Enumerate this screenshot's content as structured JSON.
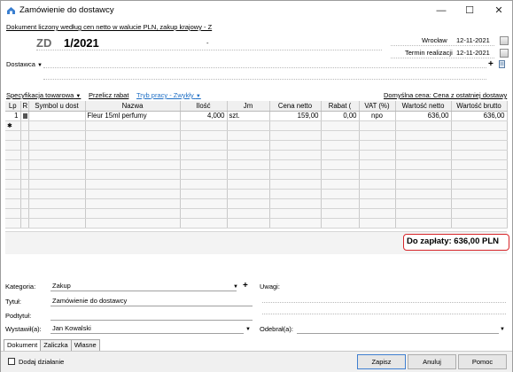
{
  "window": {
    "title": "Zamówienie do dostawcy",
    "minimize": "—",
    "maximize": "☐",
    "close": "✕"
  },
  "header": {
    "info_link": "Dokument liczony według cen netto w walucie PLN, zakup krajowy - Z",
    "doc_type": "ZD",
    "doc_number": "1/2021",
    "dash": "-",
    "place_label": "Wrocław",
    "place_date": "12-11-2021",
    "term_label": "Termin realizacji",
    "term_date": "12-11-2021",
    "supplier_label": "Dostawca",
    "plus": "+"
  },
  "toolbar": {
    "spec_label": "Specyfikacja towarowa",
    "recalc_label": "Przelicz rabat",
    "mode_label": "Tryb pracy - Zwykły",
    "default_price_label": "Domyślna cena: Cena z ostatniej dostawy"
  },
  "table": {
    "columns": [
      "Lp",
      "R",
      "Symbol u dost",
      "Nazwa",
      "Ilość",
      "Jm",
      "Cena netto",
      "Rabat (",
      "VAT (%)",
      "Wartość netto",
      "Wartość brutto"
    ],
    "rows": [
      [
        "1",
        "",
        "",
        "Fleur 15ml perfumy",
        "4,000",
        "szt.",
        "159,00",
        "0,00",
        "npo",
        "636,00",
        "636,00"
      ]
    ],
    "new_row_marker": "✱",
    "empty_rows": 11
  },
  "summary": {
    "to_pay": "Do zapłaty: 636,00 PLN"
  },
  "form": {
    "category_label": "Kategoria:",
    "category_value": "Zakup",
    "notes_label": "Uwagi:",
    "title_label": "Tytuł:",
    "title_value": "Zamówienie do dostawcy",
    "subtitle_label": "Podtytuł:",
    "issued_label": "Wystawił(a):",
    "issued_value": "Jan Kowalski",
    "received_label": "Odebrał(a):",
    "plus": "+"
  },
  "tabs": [
    "Dokument",
    "Zaliczka",
    "Własne"
  ],
  "footer": {
    "add_action_label": "Dodaj działanie",
    "save": "Zapisz",
    "cancel": "Anuluj",
    "help": "Pomoc"
  },
  "colors": {
    "accent_red": "#d7262a",
    "link_blue": "#1f6fc5"
  }
}
